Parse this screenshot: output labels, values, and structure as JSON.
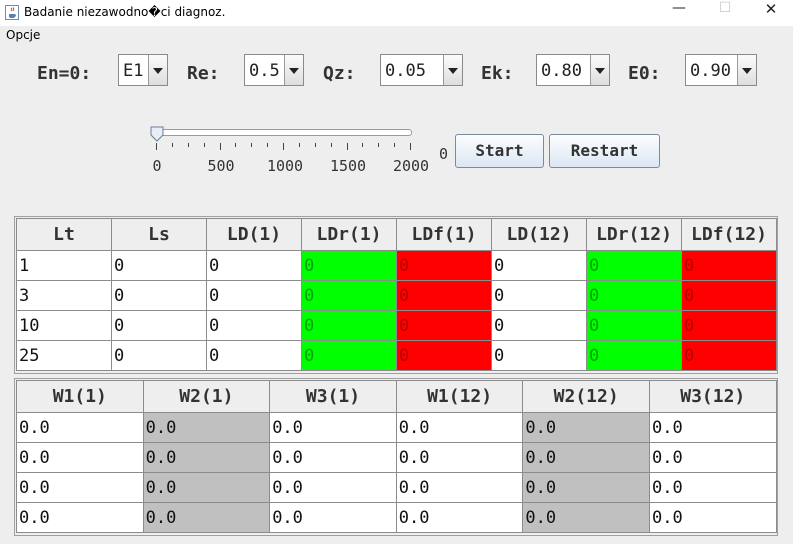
{
  "window": {
    "title": "Badanie niezawodno�ci diagnoz.",
    "minimize_glyph": "—",
    "maximize_glyph": "☐",
    "close_glyph": "✕"
  },
  "menu": {
    "items": [
      "Opcje"
    ]
  },
  "params": [
    {
      "label": "En=0:",
      "value": "E1"
    },
    {
      "label": "Re:",
      "value": "0.5"
    },
    {
      "label": "Qz:",
      "value": "0.05"
    },
    {
      "label": "Ek:",
      "value": "0.80"
    },
    {
      "label": "E0:",
      "value": "0.90"
    }
  ],
  "slider": {
    "min": 0,
    "max": 2000,
    "value": 0,
    "tick_labels": [
      "0",
      "500",
      "1000",
      "1500",
      "2000"
    ],
    "value_text": "0"
  },
  "buttons": {
    "start": "Start",
    "restart": "Restart"
  },
  "table_ld": {
    "headers": [
      "Lt",
      "Ls",
      "LD(1)",
      "LDr(1)",
      "LDf(1)",
      "LD(12)",
      "LDr(12)",
      "LDf(12)"
    ],
    "rows": [
      [
        "1",
        "0",
        "0",
        "0",
        "0",
        "0",
        "0",
        "0"
      ],
      [
        "3",
        "0",
        "0",
        "0",
        "0",
        "0",
        "0",
        "0"
      ],
      [
        "10",
        "0",
        "0",
        "0",
        "0",
        "0",
        "0",
        "0"
      ],
      [
        "25",
        "0",
        "0",
        "0",
        "0",
        "0",
        "0",
        "0"
      ]
    ]
  },
  "table_w": {
    "headers": [
      "W1(1)",
      "W2(1)",
      "W3(1)",
      "W1(12)",
      "W2(12)",
      "W3(12)"
    ],
    "rows": [
      [
        "0.0",
        "0.0",
        "0.0",
        "0.0",
        "0.0",
        "0.0"
      ],
      [
        "0.0",
        "0.0",
        "0.0",
        "0.0",
        "0.0",
        "0.0"
      ],
      [
        "0.0",
        "0.0",
        "0.0",
        "0.0",
        "0.0",
        "0.0"
      ],
      [
        "0.0",
        "0.0",
        "0.0",
        "0.0",
        "0.0",
        "0.0"
      ]
    ]
  },
  "colors": {
    "ldr_cell": "#00ff00",
    "ldf_cell": "#ff0000",
    "ldr_text": "#00a000",
    "ldf_text": "#b00000",
    "w2_cell": "#c0c0c0"
  }
}
